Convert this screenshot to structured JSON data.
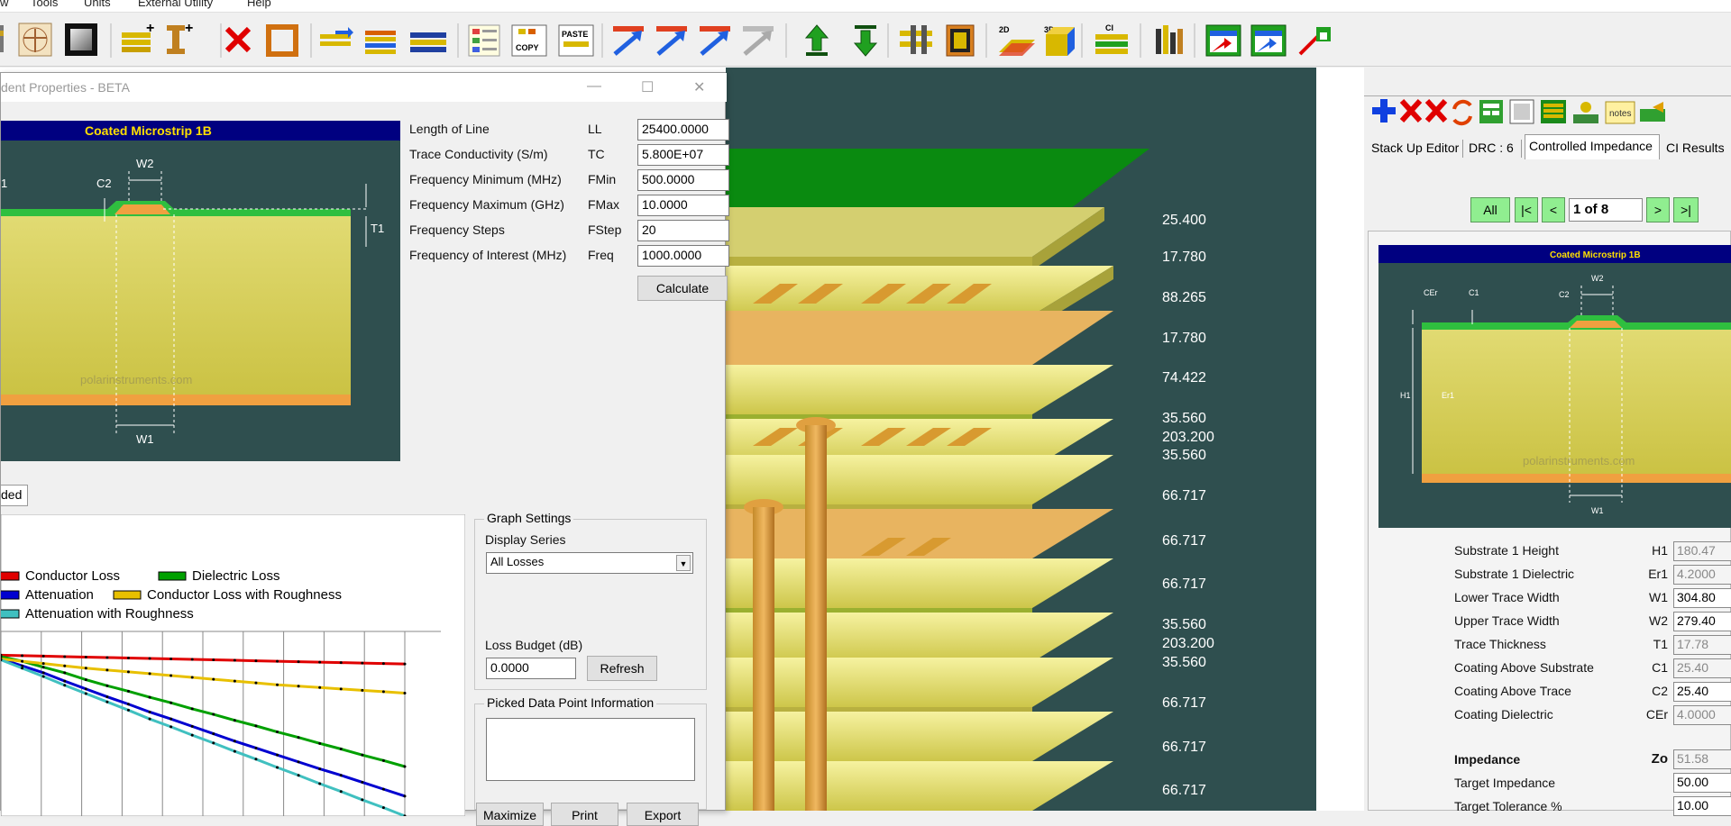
{
  "menu": {
    "items": [
      "w",
      "Tools",
      "Units",
      "External Utility",
      "Help"
    ]
  },
  "toolbar": {
    "icons": [
      "layer-stack-icon",
      "vitruvian-man-icon",
      "picture-frame-icon",
      "add-dielectric-icon",
      "add-via-icon",
      "delete-icon",
      "copper-frame-icon",
      "add-layer-icon",
      "stack-layers-icon",
      "layer-stripes-icon",
      "checklist-icon",
      "copy-icon",
      "paste-icon",
      "arrow-upright-red-icon",
      "arrow-upright-blue-icon",
      "arrow-upright-red2-icon",
      "arrow-upright-disabled-icon",
      "arrow-up-green-icon",
      "arrow-down-green-icon",
      "via-drill-icon",
      "reel-icon",
      "view-2d-icon",
      "view-3d-icon",
      "controlled-impedance-icon",
      "report-icon",
      "export-excel-icon",
      "export-excel2-icon",
      "wand-icon"
    ],
    "labels": {
      "copy": "COPY",
      "paste": "PASTE",
      "two_d": "2D",
      "three_d": "3D",
      "ci": "CI"
    }
  },
  "dialog": {
    "title": "dent Properties - BETA",
    "diagram_title": "Coated Microstrip 1B",
    "diagram_labels": {
      "c2": "C2",
      "w2": "W2",
      "t1": "T1",
      "w1": "W1",
      "c1": "1",
      "site": "polarinstruments.com"
    },
    "params": [
      {
        "label": "Length of Line",
        "code": "LL",
        "value": "25400.0000"
      },
      {
        "label": "Trace Conductivity (S/m)",
        "code": "TC",
        "value": "5.800E+07"
      },
      {
        "label": "Frequency Minimum (MHz)",
        "code": "FMin",
        "value": "500.0000"
      },
      {
        "label": "Frequency Maximum (GHz)",
        "code": "FMax",
        "value": "10.0000"
      },
      {
        "label": "Frequency Steps",
        "code": "FStep",
        "value": "20"
      },
      {
        "label": "Frequency of Interest (MHz)",
        "code": "Freq",
        "value": "1000.0000"
      }
    ],
    "calculate": "Calculate",
    "tab_label": "ded",
    "graph_settings": {
      "title": "Graph Settings",
      "display_series_label": "Display Series",
      "display_series_value": "All Losses",
      "loss_budget_label": "Loss Budget (dB)",
      "loss_budget_value": "0.0000",
      "refresh": "Refresh"
    },
    "picked_point": {
      "title": "Picked Data Point Information",
      "value": ""
    },
    "bottom_buttons": [
      "Maximize",
      "Print",
      "Export"
    ]
  },
  "chart_data": {
    "type": "line",
    "title": "",
    "xlabel": "",
    "ylabel": "",
    "legend_position": "top",
    "grid": true,
    "x": [
      500,
      1000,
      1500,
      2000,
      2500,
      3000,
      3500,
      4000,
      4500,
      5000,
      5500,
      6000,
      6500,
      7000,
      7500,
      8000,
      8500,
      9000,
      9500,
      10000
    ],
    "series": [
      {
        "name": "Conductor Loss",
        "color": "#e00000",
        "values": [
          -0.02,
          -0.03,
          -0.04,
          -0.05,
          -0.06,
          -0.07,
          -0.08,
          -0.09,
          -0.1,
          -0.11,
          -0.12,
          -0.13,
          -0.14,
          -0.15,
          -0.16,
          -0.17,
          -0.18,
          -0.19,
          -0.2,
          -0.21
        ]
      },
      {
        "name": "Dielectric Loss",
        "color": "#00a000",
        "values": [
          -0.05,
          -0.15,
          -0.28,
          -0.4,
          -0.55,
          -0.68,
          -0.8,
          -0.93,
          -1.05,
          -1.18,
          -1.3,
          -1.43,
          -1.55,
          -1.68,
          -1.8,
          -1.93,
          -2.05,
          -2.18,
          -2.3,
          -2.43
        ]
      },
      {
        "name": "Attenuation",
        "color": "#0000d0",
        "values": [
          -0.1,
          -0.25,
          -0.4,
          -0.58,
          -0.75,
          -0.92,
          -1.08,
          -1.25,
          -1.4,
          -1.56,
          -1.72,
          -1.88,
          -2.03,
          -2.18,
          -2.33,
          -2.48,
          -2.62,
          -2.77,
          -2.92,
          -3.07
        ]
      },
      {
        "name": "Conductor Loss with Roughness",
        "color": "#e8c000",
        "values": [
          -0.1,
          -0.15,
          -0.2,
          -0.25,
          -0.3,
          -0.34,
          -0.38,
          -0.42,
          -0.46,
          -0.5,
          -0.54,
          -0.58,
          -0.62,
          -0.66,
          -0.69,
          -0.72,
          -0.75,
          -0.78,
          -0.81,
          -0.84
        ]
      },
      {
        "name": "Attenuation with Roughness",
        "color": "#40c0c0",
        "values": [
          -0.12,
          -0.3,
          -0.48,
          -0.67,
          -0.85,
          -1.03,
          -1.21,
          -1.4,
          -1.57,
          -1.75,
          -1.92,
          -2.1,
          -2.27,
          -2.45,
          -2.62,
          -2.8,
          -2.97,
          -3.15,
          -3.32,
          -3.5
        ]
      }
    ]
  },
  "stack": {
    "values": [
      "25.400",
      "17.780",
      "88.265",
      "17.780",
      "74.422",
      "35.560",
      "203.200",
      "35.560",
      "66.717",
      "66.717",
      "66.717",
      "35.560",
      "203.200",
      "35.560",
      "66.717",
      "66.717",
      "66.717"
    ]
  },
  "right_panel": {
    "tabs": [
      "Stack Up Editor",
      "DRC : 6",
      "Controlled Impedance",
      "CI Results"
    ],
    "nav": {
      "all": "All",
      "first": "|<",
      "prev": "<",
      "page": "1 of 8",
      "next": ">",
      "last": ">|"
    },
    "tool_icons": [
      "add-icon",
      "delete-red-icon",
      "delete-all-icon",
      "refresh-icon",
      "calculator-icon",
      "page-icon",
      "matrix-icon",
      "person-icon",
      "notes-icon",
      "export-icon"
    ],
    "notes_label": "notes",
    "diagram_title": "Coated Microstrip 1B",
    "diagram_labels": {
      "cer": "CEr",
      "c1": "C1",
      "c2": "C2",
      "w2": "W2",
      "h1": "H1",
      "er1": "Er1",
      "w1": "W1",
      "site": "polarinstruments.com"
    },
    "params": [
      {
        "label": "Substrate 1 Height",
        "code": "H1",
        "value": "180.47",
        "readonly": true
      },
      {
        "label": "Substrate 1 Dielectric",
        "code": "Er1",
        "value": "4.2000",
        "readonly": true
      },
      {
        "label": "Lower Trace Width",
        "code": "W1",
        "value": "304.80",
        "readonly": false
      },
      {
        "label": "Upper Trace Width",
        "code": "W2",
        "value": "279.40",
        "readonly": false
      },
      {
        "label": "Trace Thickness",
        "code": "T1",
        "value": "17.78",
        "readonly": true
      },
      {
        "label": "Coating Above Substrate",
        "code": "C1",
        "value": "25.40",
        "readonly": true
      },
      {
        "label": "Coating Above Trace",
        "code": "C2",
        "value": "25.40",
        "readonly": false
      },
      {
        "label": "Coating Dielectric",
        "code": "CEr",
        "value": "4.0000",
        "readonly": true
      }
    ],
    "impedance": {
      "label": "Impedance",
      "code": "Zo",
      "value": "51.58"
    },
    "target_impedance": {
      "label": "Target Impedance",
      "value": "50.00"
    },
    "target_tolerance": {
      "label": "Target Tolerance %",
      "value": "10.00"
    }
  }
}
